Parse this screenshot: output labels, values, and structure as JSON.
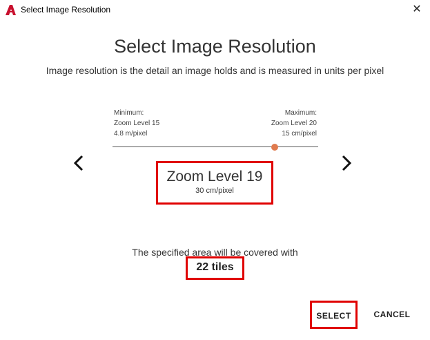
{
  "window": {
    "title": "Select Image Resolution",
    "close_glyph": "✕",
    "app_icon": "autocad-a-icon"
  },
  "dialog": {
    "heading": "Select Image Resolution",
    "description": "Image resolution is the detail an image holds and is measured in units per pixel"
  },
  "range": {
    "min": {
      "label": "Minimum:",
      "level": "Zoom Level 15",
      "resolution": "4.8 m/pixel"
    },
    "max": {
      "label": "Maximum:",
      "level": "Zoom Level 20",
      "resolution": "15 cm/pixel"
    },
    "slider_position": 0.79
  },
  "selection": {
    "level": "Zoom Level 19",
    "resolution": "30 cm/pixel"
  },
  "coverage": {
    "text": "The specified area will be covered with",
    "tiles": "22 tiles"
  },
  "buttons": {
    "select": "SELECT",
    "cancel": "CANCEL"
  },
  "colors": {
    "accent": "#e07b4f",
    "highlight": "#e00000",
    "app_icon": "#c8102e"
  }
}
